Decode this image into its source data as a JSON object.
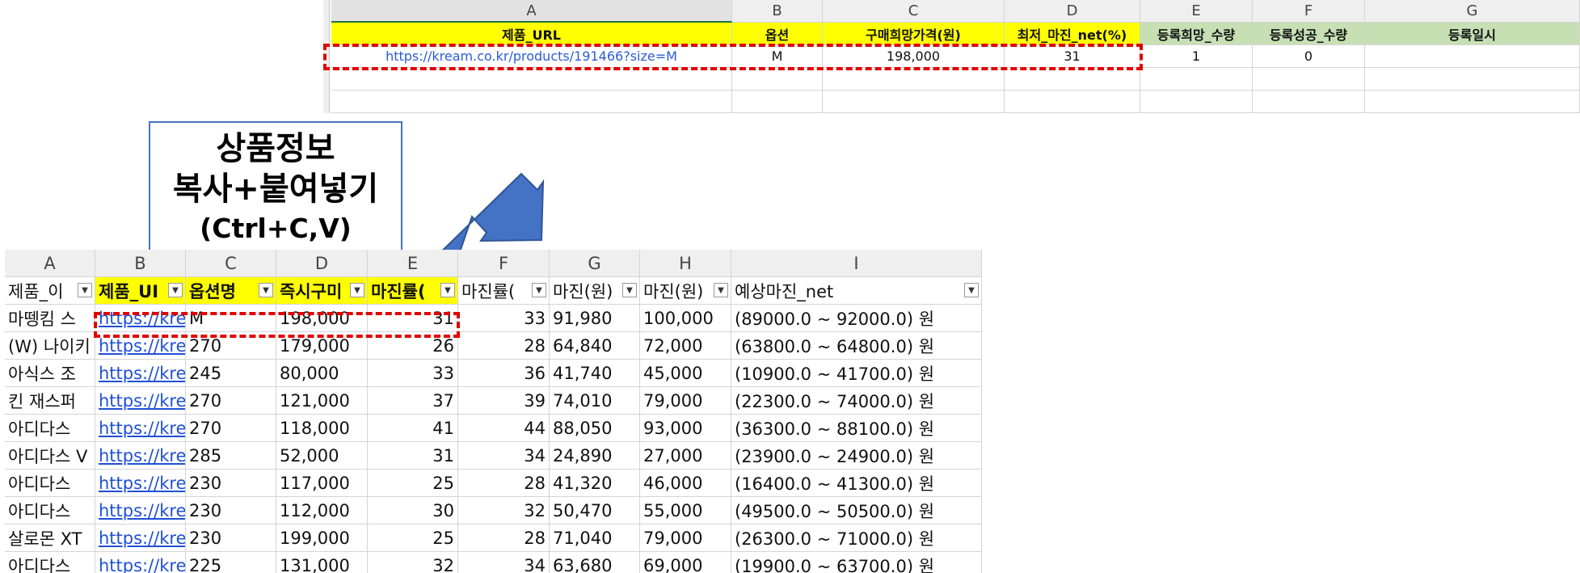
{
  "top_sheet": {
    "columns": [
      "A",
      "B",
      "C",
      "D",
      "E",
      "F",
      "G"
    ],
    "headers": [
      "제품_URL",
      "옵션",
      "구매희망가격(원)",
      "최저_마진_net(%)",
      "등록희망_수량",
      "등록성공_수량",
      "등록일시"
    ],
    "header_colors": [
      "#ffff00",
      "#ffff00",
      "#ffff00",
      "#ffff00",
      "#c6e0b4",
      "#c6e0b4",
      "#c6e0b4"
    ],
    "row": [
      "https://kream.co.kr/products/191466?size=M",
      "M",
      "198,000",
      "31",
      "1",
      "0",
      ""
    ]
  },
  "callout": {
    "line1": "상품정보",
    "line2": "복사+붙여넣기",
    "line3": "(Ctrl+C,V)"
  },
  "bottom_sheet": {
    "columns": [
      "A",
      "B",
      "C",
      "D",
      "E",
      "F",
      "G",
      "H",
      "I"
    ],
    "headers": [
      "제품_이",
      "제품_UI",
      "옵션명",
      "즉시구미",
      "마진률(",
      "마진률(",
      "마진(원)",
      "마진(원)",
      "예상마진_net"
    ],
    "rows": [
      [
        "마뗑킴 스",
        "https://kre",
        "M",
        "198,000",
        "31",
        "33",
        "91,980",
        "100,000",
        "(89000.0 ~ 92000.0) 원"
      ],
      [
        "(W) 나이키",
        "https://kre",
        "270",
        "179,000",
        "26",
        "28",
        "64,840",
        "72,000",
        "(63800.0 ~ 64800.0) 원"
      ],
      [
        "아식스 조",
        "https://kre",
        "245",
        "80,000",
        "33",
        "36",
        "41,740",
        "45,000",
        "(10900.0 ~ 41700.0) 원"
      ],
      [
        "킨 재스퍼",
        "https://kre",
        "270",
        "121,000",
        "37",
        "39",
        "74,010",
        "79,000",
        "(22300.0 ~ 74000.0) 원"
      ],
      [
        "아디다스",
        "https://kre",
        "270",
        "118,000",
        "41",
        "44",
        "88,050",
        "93,000",
        "(36300.0 ~ 88100.0) 원"
      ],
      [
        "아디다스 V",
        "https://kre",
        "285",
        "52,000",
        "31",
        "34",
        "24,890",
        "27,000",
        "(23900.0 ~ 24900.0) 원"
      ],
      [
        "아디다스",
        "https://kre",
        "230",
        "117,000",
        "25",
        "28",
        "41,320",
        "46,000",
        "(16400.0 ~ 41300.0) 원"
      ],
      [
        "아디다스",
        "https://kre",
        "230",
        "112,000",
        "30",
        "32",
        "50,470",
        "55,000",
        "(49500.0 ~ 50500.0) 원"
      ],
      [
        "살로몬 XT",
        "https://kre",
        "230",
        "199,000",
        "25",
        "28",
        "71,040",
        "79,000",
        "(26300.0 ~ 71000.0) 원"
      ],
      [
        "아디다스",
        "https://kre",
        "225",
        "131,000",
        "32",
        "34",
        "63,680",
        "69,000",
        "(19900.0 ~ 63700.0) 원"
      ]
    ]
  },
  "colors": {
    "highlight_dash": "#e00000",
    "arrow": "#4472c4",
    "header_yellow": "#ffff00",
    "header_green": "#c6e0b4",
    "link": "#1f4fd6"
  }
}
